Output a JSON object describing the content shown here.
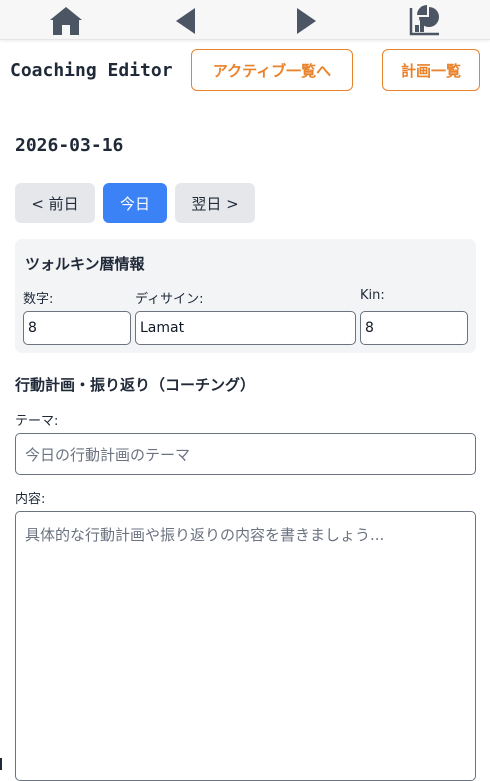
{
  "nav": {
    "icons": [
      "home-icon",
      "back-arrow-icon",
      "forward-arrow-icon",
      "chart-icon"
    ]
  },
  "header": {
    "title": "Coaching Editor",
    "active_list_label": "アクティブ一覧へ",
    "plan_list_label": "計画一覧"
  },
  "date": "2026-03-16",
  "day_nav": {
    "prev_label": "< 前日",
    "today_label": "今日",
    "next_label": "翌日 >"
  },
  "tzolkin": {
    "title": "ツォルキン暦情報",
    "number_label": "数字:",
    "number_value": "8",
    "design_label": "ディサイン:",
    "design_value": "Lamat",
    "kin_label": "Kin:",
    "kin_value": "8"
  },
  "coaching": {
    "section_title": "行動計画・振り返り（コーチング）",
    "theme_label": "テーマ:",
    "theme_placeholder": "今日の行動計画のテーマ",
    "content_label": "内容:",
    "content_placeholder": "具体的な行動計画や振り返りの内容を書きましょう..."
  },
  "colors": {
    "accent_orange": "#e8822b",
    "primary_blue": "#3b82f6",
    "button_grey": "#e5e7eb",
    "panel_bg": "#f3f4f6",
    "nav_icon": "#4b5563"
  }
}
